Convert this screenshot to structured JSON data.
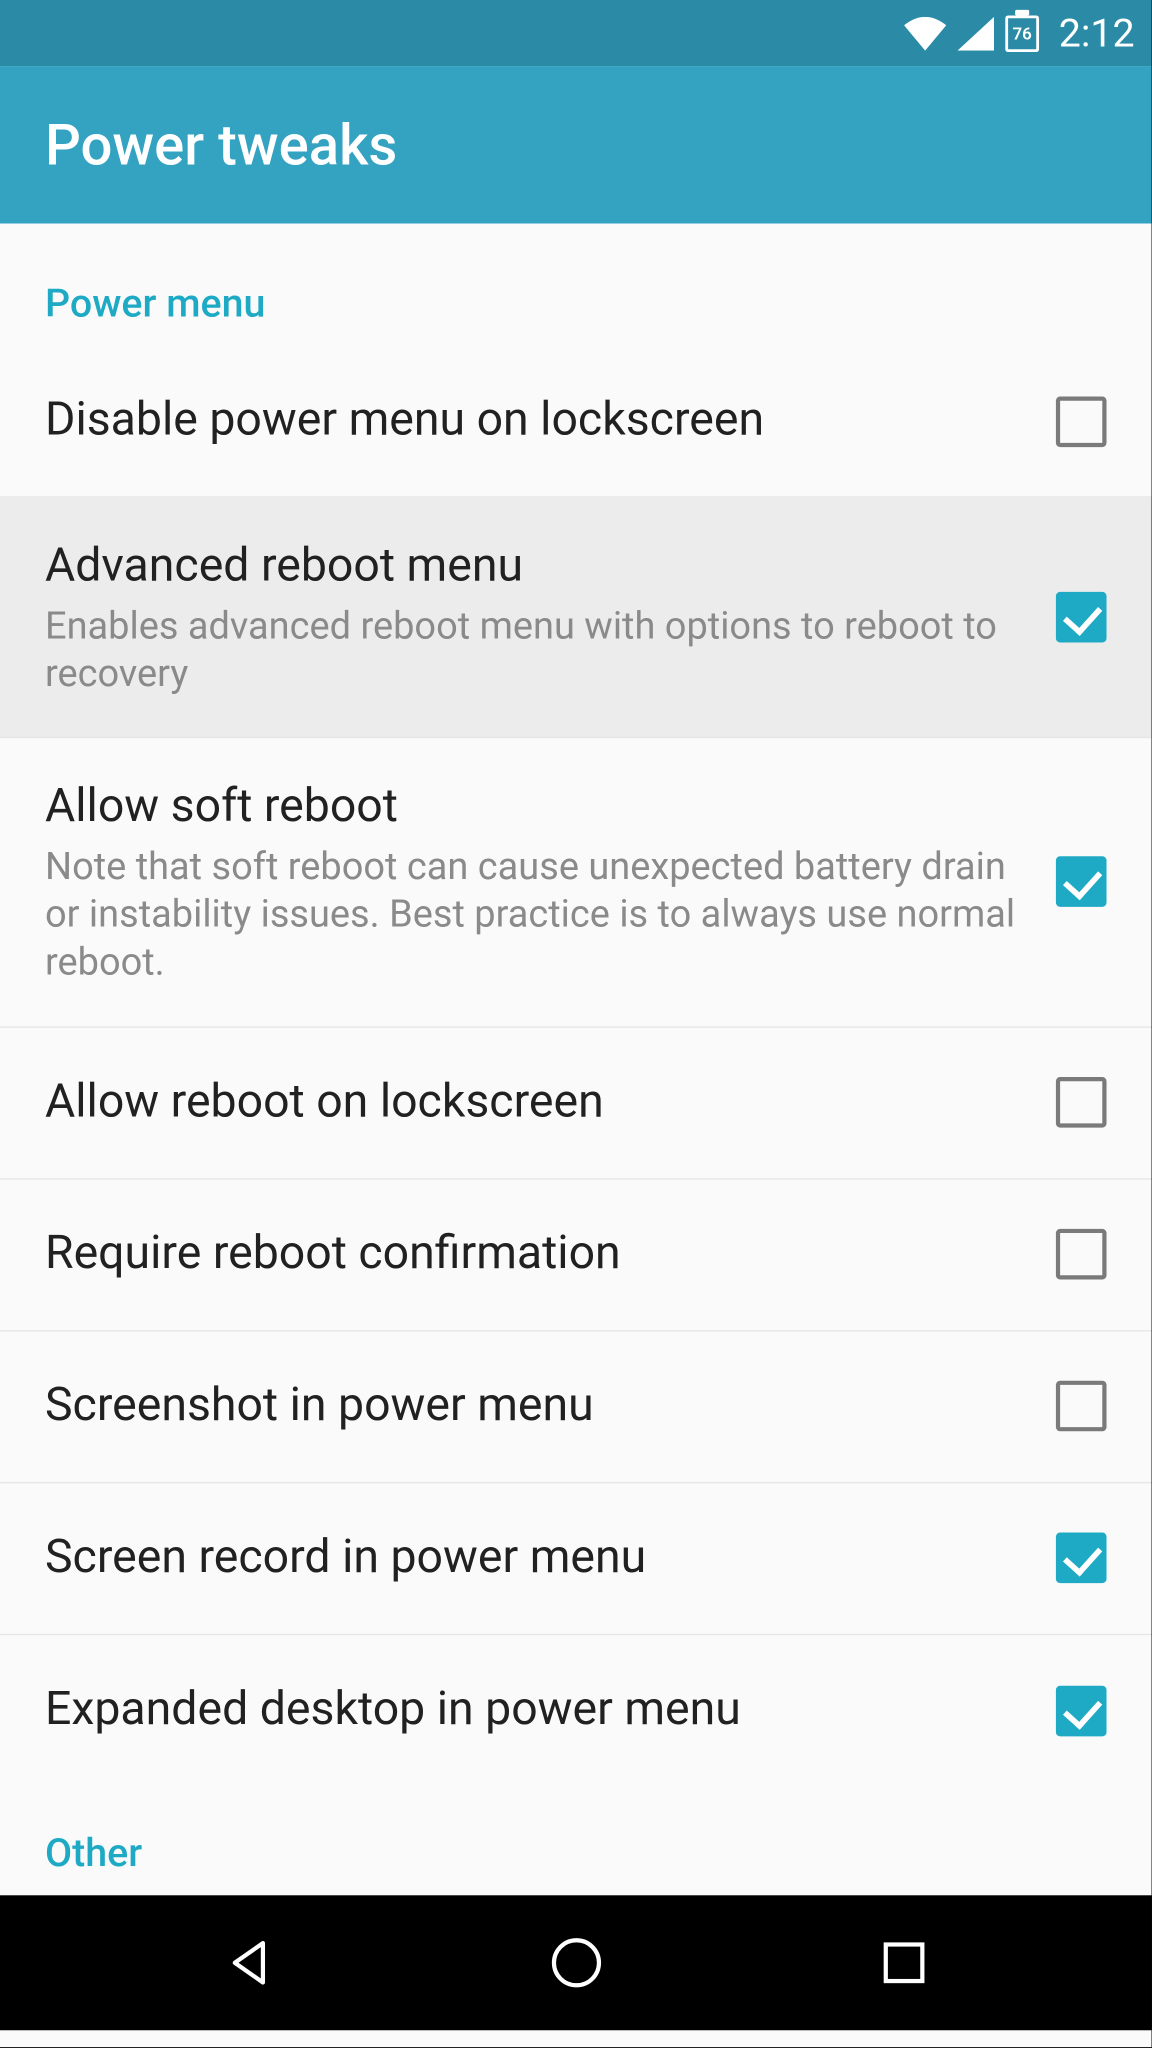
{
  "status_bar": {
    "battery_level": "76",
    "time": "2:12"
  },
  "app_bar": {
    "title": "Power tweaks"
  },
  "sections": {
    "power_menu": {
      "header": "Power menu",
      "items": [
        {
          "title": "Disable power menu on lockscreen",
          "subtitle": "",
          "checked": false,
          "highlighted": false
        },
        {
          "title": "Advanced reboot menu",
          "subtitle": "Enables advanced reboot menu with options to reboot to recovery",
          "checked": true,
          "highlighted": true
        },
        {
          "title": "Allow soft reboot",
          "subtitle": "Note that soft reboot can cause unexpected battery drain or instability issues. Best practice is to always use normal reboot.",
          "checked": true,
          "highlighted": false
        },
        {
          "title": "Allow reboot on lockscreen",
          "subtitle": "",
          "checked": false,
          "highlighted": false
        },
        {
          "title": "Require reboot confirmation",
          "subtitle": "",
          "checked": false,
          "highlighted": false
        },
        {
          "title": "Screenshot in power menu",
          "subtitle": "",
          "checked": false,
          "highlighted": false
        },
        {
          "title": "Screen record in power menu",
          "subtitle": "",
          "checked": true,
          "highlighted": false
        },
        {
          "title": "Expanded desktop in power menu",
          "subtitle": "",
          "checked": true,
          "highlighted": false
        }
      ]
    },
    "other": {
      "header": "Other"
    }
  },
  "colors": {
    "accent": "#1eaac4",
    "status_bar_bg": "#2b8ba7",
    "app_bar_bg": "#33a3c1"
  }
}
